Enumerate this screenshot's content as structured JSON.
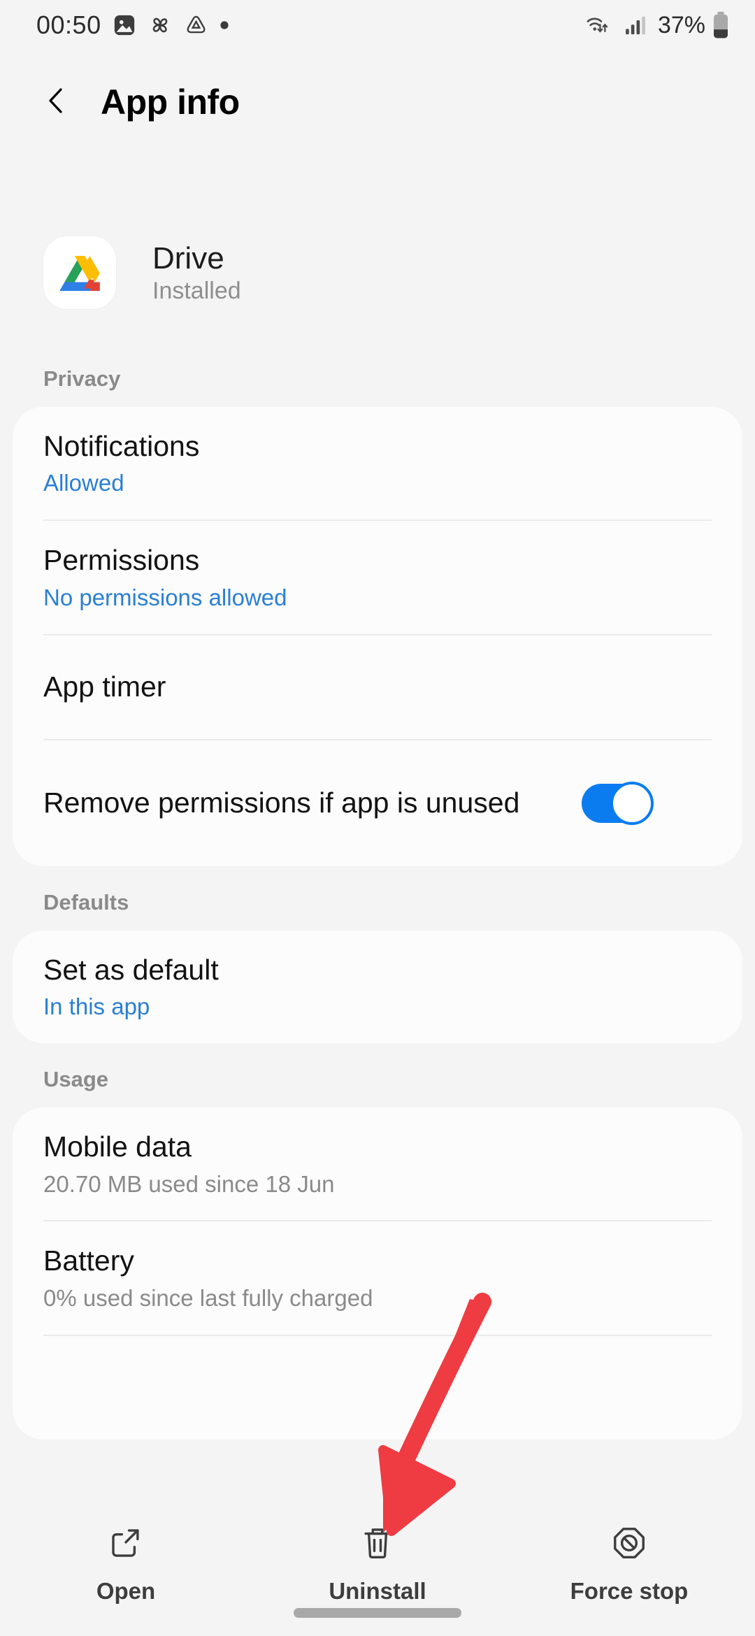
{
  "status_bar": {
    "time": "00:50",
    "left_icons": [
      "gallery-icon",
      "pinwheel-icon",
      "drive-triangle-icon",
      "dot-icon"
    ],
    "wifi_icon": "wifi-updown-icon",
    "signal_icon": "cellular-signal-icon",
    "battery_percent": "37%",
    "battery_icon": "battery-icon"
  },
  "header": {
    "back_icon": "chevron-left-icon",
    "title": "App info"
  },
  "app": {
    "icon": "google-drive-icon",
    "name": "Drive",
    "state": "Installed"
  },
  "sections": [
    {
      "label": "Privacy",
      "rows": [
        {
          "title": "Notifications",
          "sub": "Allowed",
          "sub_style": "blue",
          "control": "none"
        },
        {
          "title": "Permissions",
          "sub": "No permissions allowed",
          "sub_style": "blue",
          "control": "none"
        },
        {
          "title": "App timer",
          "sub": "",
          "sub_style": "none",
          "control": "none"
        },
        {
          "title": "Remove permissions if app is unused",
          "sub": "",
          "sub_style": "none",
          "control": "toggle",
          "toggle_on": true
        }
      ]
    },
    {
      "label": "Defaults",
      "rows": [
        {
          "title": "Set as default",
          "sub": "In this app",
          "sub_style": "blue",
          "control": "none"
        }
      ]
    },
    {
      "label": "Usage",
      "rows": [
        {
          "title": "Mobile data",
          "sub": "20.70 MB used since 18 Jun",
          "sub_style": "gray",
          "control": "none"
        },
        {
          "title": "Battery",
          "sub": "0% used since last fully charged",
          "sub_style": "gray",
          "control": "none"
        }
      ]
    }
  ],
  "bottom_bar": {
    "buttons": [
      {
        "label": "Open",
        "icon": "open-external-icon"
      },
      {
        "label": "Uninstall",
        "icon": "trash-icon"
      },
      {
        "label": "Force stop",
        "icon": "force-stop-icon"
      }
    ]
  },
  "annotation": {
    "type": "arrow",
    "color": "#ef3b42",
    "points_to": "Uninstall"
  },
  "colors": {
    "page_background": "#f4f4f4",
    "card_background": "#fcfcfc",
    "link_blue": "#2a7fd4",
    "toggle_blue": "#0a7cf0",
    "arrow_red": "#ef3b42"
  }
}
